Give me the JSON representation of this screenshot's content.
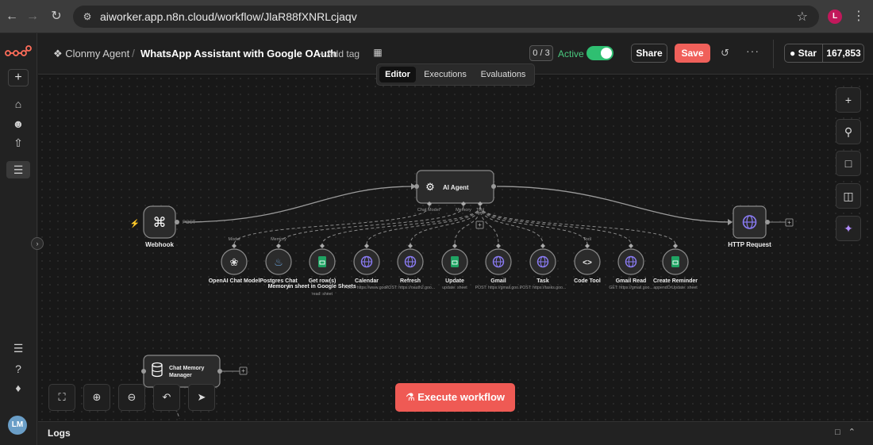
{
  "browser": {
    "url": "aiworker.app.n8n.cloud/workflow/JlaR88fXNRLcjaqv",
    "profile_initial": "L"
  },
  "sidebar": {
    "logo": "n8n-logo",
    "avatar_initials": "LM"
  },
  "header": {
    "project": "Clonmy Agent",
    "separator": "/",
    "workflow_title": "WhatsApp Assistant with Google OAuth",
    "add_tag": "+ Add tag",
    "counter": "0 / 3",
    "active_label": "Active",
    "active": true,
    "share_label": "Share",
    "save_label": "Save",
    "github_star_label": "Star",
    "github_star_count": "167,853"
  },
  "tabs": [
    {
      "label": "Editor",
      "selected": true
    },
    {
      "label": "Executions",
      "selected": false
    },
    {
      "label": "Evaluations",
      "selected": false
    }
  ],
  "nodes": {
    "webhook": {
      "label": "Webhook",
      "handle": "POST"
    },
    "agent": {
      "label": "AI Agent",
      "ports": [
        "Chat Model*",
        "Memory",
        "Tool"
      ]
    },
    "http": {
      "label": "HTTP Request"
    },
    "memory_manager": {
      "label": "Chat Memory Manager"
    },
    "sub_nodes": [
      {
        "label": "OpenAI Chat Model",
        "sub": "",
        "icon": "openai-icon",
        "port_label": "Model"
      },
      {
        "label": "Postgres Chat Memory",
        "sub": "",
        "icon": "postgres-icon",
        "port_label": "Memory"
      },
      {
        "label": "Get row(s) in sheet in Google Sheets",
        "sub": "read: sheet",
        "icon": "sheets-icon",
        "port_label": ""
      },
      {
        "label": "Calendar",
        "sub": "POST: https://www.goo...",
        "icon": "globe-icon",
        "port_label": ""
      },
      {
        "label": "Refresh",
        "sub": "POST: https://oauth2.goo...",
        "icon": "globe-icon",
        "port_label": ""
      },
      {
        "label": "Update",
        "sub": "update: sheet",
        "icon": "sheets-icon",
        "port_label": ""
      },
      {
        "label": "Gmail",
        "sub": "POST: https://gmail.goo...",
        "icon": "globe-icon",
        "port_label": ""
      },
      {
        "label": "Task",
        "sub": "POST: https://tasks.goo...",
        "icon": "globe-icon",
        "port_label": ""
      },
      {
        "label": "Code Tool",
        "sub": "",
        "icon": "code-icon",
        "port_label": "Tool"
      },
      {
        "label": "Gmail Read",
        "sub": "GET: https://gmail.goo...",
        "icon": "globe-icon",
        "port_label": ""
      },
      {
        "label": "Create Reminder",
        "sub": "appendOrUpdate: sheet",
        "icon": "sheets-icon",
        "port_label": ""
      }
    ]
  },
  "canvas_controls": {
    "execute_label": "Execute workflow"
  },
  "logs": {
    "label": "Logs"
  },
  "colors": {
    "accent": "#ef5a54",
    "active_green": "#2fbf71",
    "tool_purple": "#7c6cf2",
    "sheets_green": "#1fa463"
  }
}
